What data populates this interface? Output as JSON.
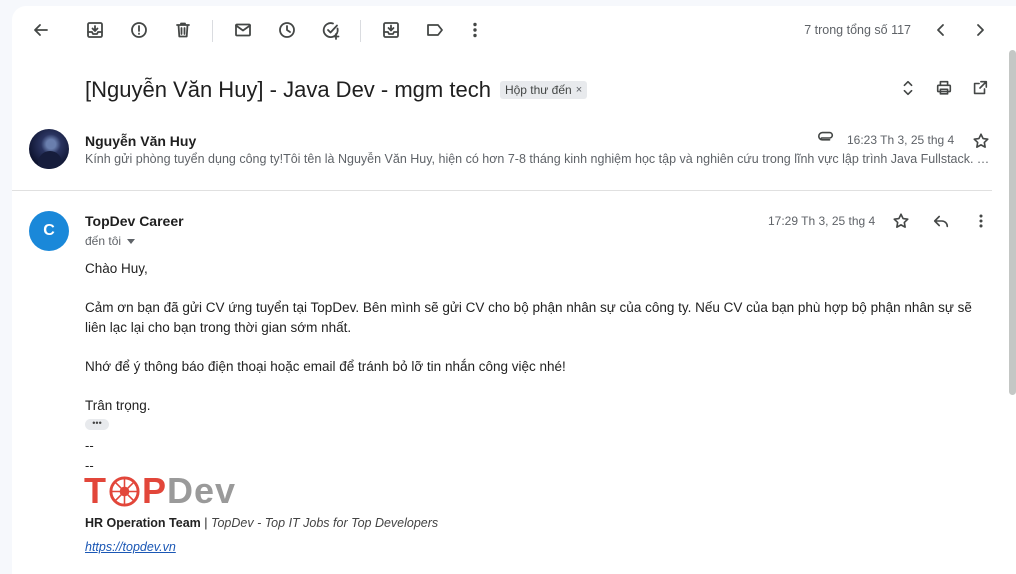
{
  "toolbar": {
    "icons": [
      "back-arrow-icon",
      "archive-icon",
      "report-spam-icon",
      "delete-icon",
      "mark-unread-icon",
      "snooze-icon",
      "add-task-icon",
      "move-to-icon",
      "label-icon",
      "more-icon"
    ],
    "pager_text": "7 trong tổng số 117"
  },
  "thread": {
    "subject": "[Nguyễn Văn Huy] - Java Dev - mgm tech",
    "label_chip": "Hộp thư đến",
    "label_remove": "×"
  },
  "message1": {
    "sender": "Nguyễn Văn Huy",
    "date": "16:23 Th 3, 25 thg 4",
    "snippet": "Kính gửi phòng tuyển dụng công ty!Tôi tên là Nguyễn Văn Huy, hiện có hơn 7-8 tháng kinh nghiệm học tập và nghiên cứu trong lĩnh vực lập trình Java Fullstack. Tôi đã tham gia nhiều dự án"
  },
  "message2": {
    "avatar_letter": "C",
    "sender": "TopDev Career",
    "date": "17:29 Th 3, 25 thg 4",
    "recipient": "đến tôi",
    "body": {
      "greeting": "Chào Huy,",
      "para1": "Cảm ơn bạn đã gửi CV ứng tuyển tại TopDev. Bên mình sẽ gửi CV cho bộ phận nhân sự của công ty. Nếu CV của bạn phù hợp bộ phận nhân sự sẽ liên lạc lại cho bạn trong thời gian sớm nhất.",
      "para2": "Nhớ để ý thông báo điện thoại hoặc email để tránh bỏ lỡ tin nhắn công việc nhé!",
      "closing": "Trân trọng.",
      "trimmed": "•••",
      "sep1": "--",
      "sep2": "--"
    },
    "signature": {
      "logo_t": "T",
      "logo_p": "P",
      "logo_dev": "Dev",
      "team": "HR Operation Team",
      "divider": " | ",
      "tagline": "TopDev - Top IT Jobs for Top Developers",
      "link": "https://topdev.vn"
    }
  },
  "colors": {
    "avatar_bg": "#1a88d9",
    "logo_red": "#e2463a",
    "logo_grey": "#9a9a9a",
    "link": "#1a57b5"
  }
}
